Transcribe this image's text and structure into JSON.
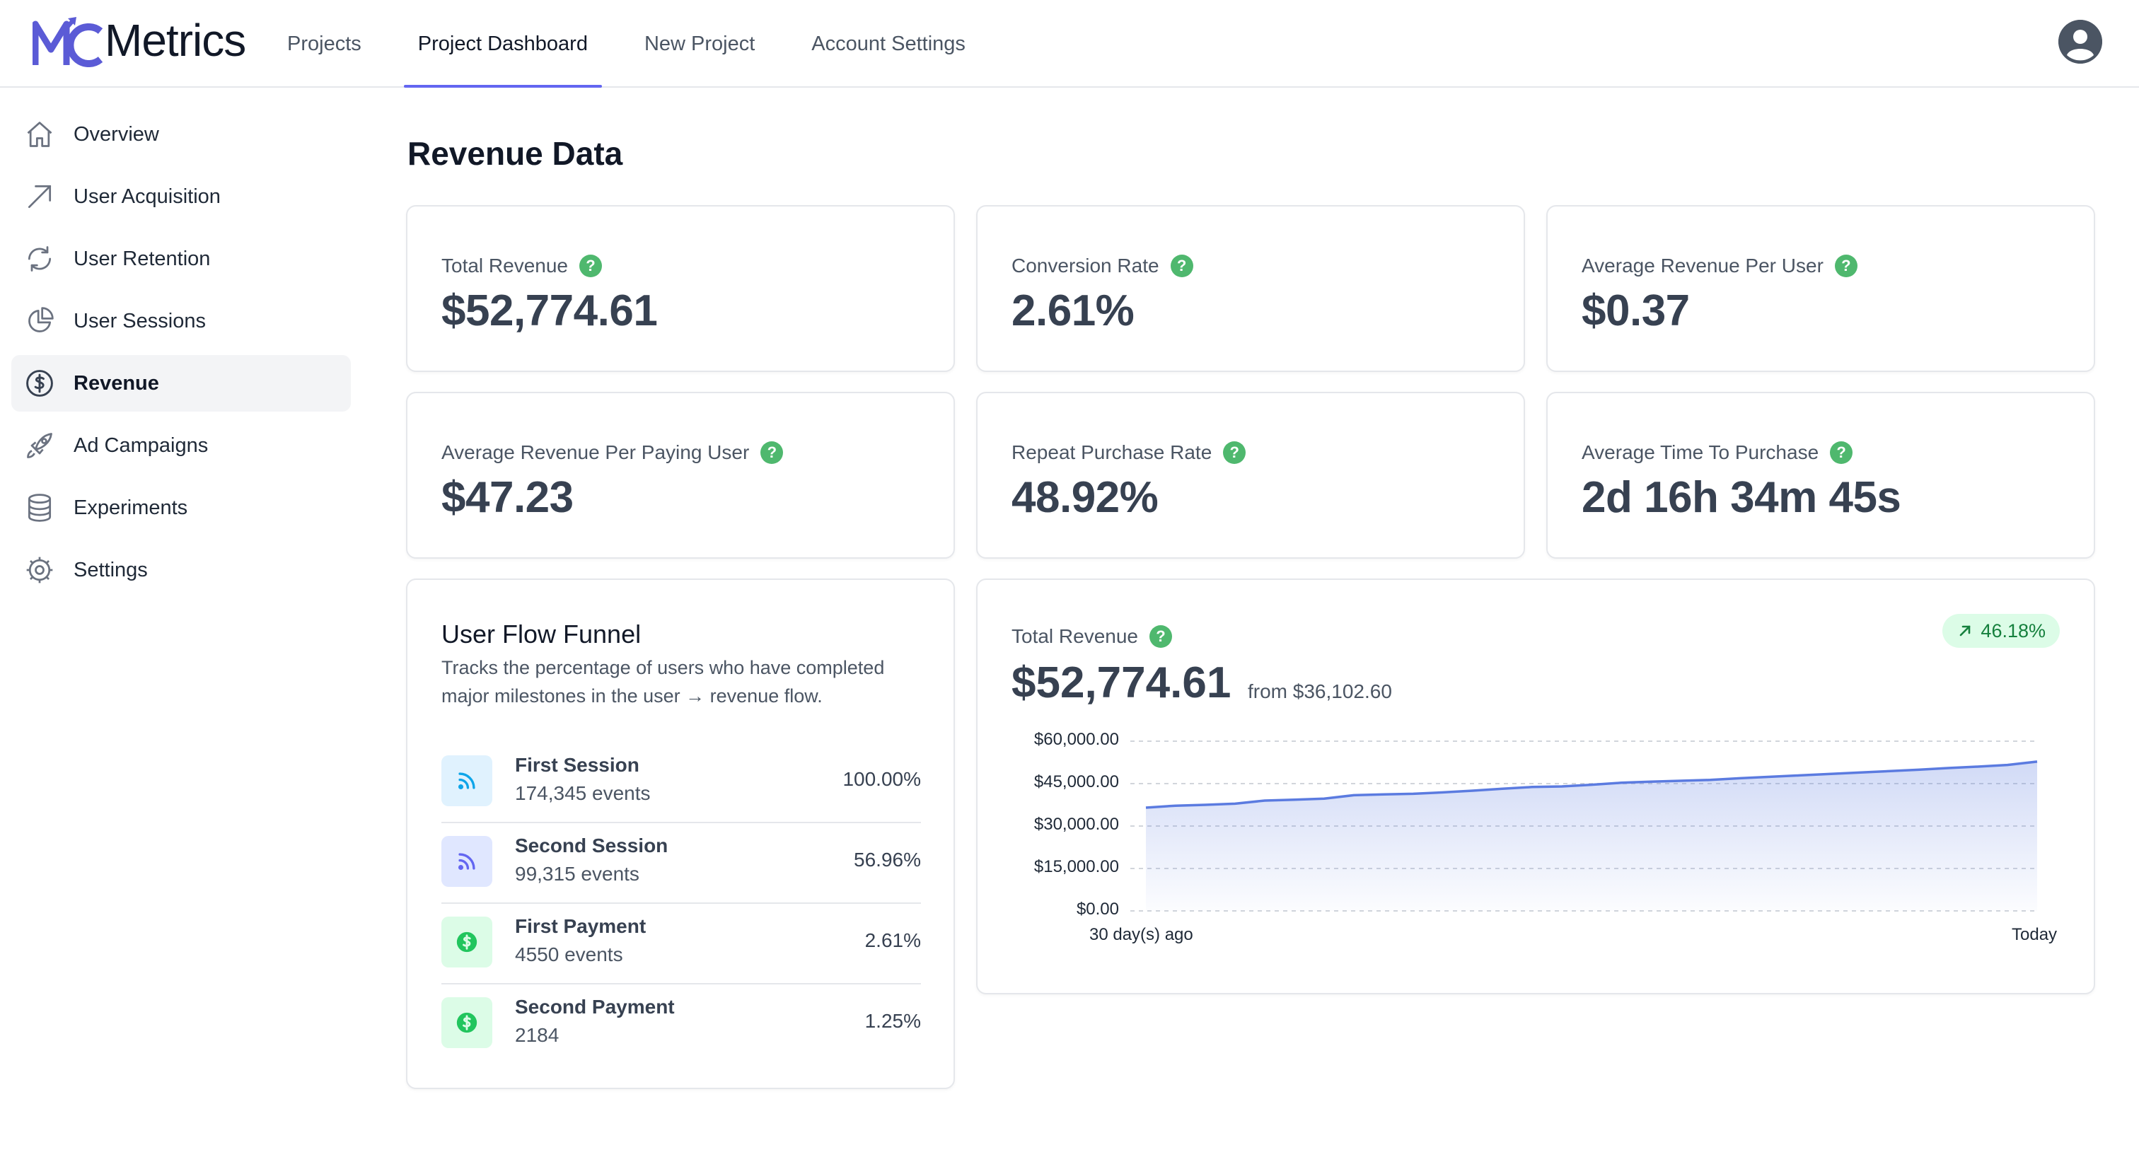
{
  "app": {
    "logo_text": "Metrics",
    "logo_mark": "MC"
  },
  "topnav": {
    "items": [
      {
        "label": "Projects"
      },
      {
        "label": "Project Dashboard",
        "active": true
      },
      {
        "label": "New Project"
      },
      {
        "label": "Account Settings"
      }
    ]
  },
  "sidebar": {
    "items": [
      {
        "label": "Overview",
        "icon": "home-icon"
      },
      {
        "label": "User Acquisition",
        "icon": "arrow-up-right-icon"
      },
      {
        "label": "User Retention",
        "icon": "refresh-icon"
      },
      {
        "label": "User Sessions",
        "icon": "pie-chart-icon"
      },
      {
        "label": "Revenue",
        "icon": "dollar-icon",
        "active": true
      },
      {
        "label": "Ad Campaigns",
        "icon": "rocket-icon"
      },
      {
        "label": "Experiments",
        "icon": "database-icon"
      },
      {
        "label": "Settings",
        "icon": "gear-icon"
      }
    ]
  },
  "main": {
    "title": "Revenue Data",
    "stats": [
      {
        "label": "Total Revenue",
        "value": "$52,774.61"
      },
      {
        "label": "Conversion Rate",
        "value": "2.61%"
      },
      {
        "label": "Average Revenue Per User",
        "value": "$0.37"
      },
      {
        "label": "Average Revenue Per Paying User",
        "value": "$47.23"
      },
      {
        "label": "Repeat Purchase Rate",
        "value": "48.92%"
      },
      {
        "label": "Average Time To Purchase",
        "value": "2d 16h 34m 45s"
      }
    ],
    "help_glyph": "?",
    "funnel": {
      "title": "User Flow Funnel",
      "description": "Tracks the percentage of users who have completed major milestones in the user → revenue flow.",
      "rows": [
        {
          "name": "First Session",
          "events": "174,345 events",
          "pct": "100.00%",
          "icon": "rss-icon",
          "tint": "#e0f2fe",
          "color": "#0ea5e9"
        },
        {
          "name": "Second Session",
          "events": "99,315 events",
          "pct": "56.96%",
          "icon": "rss-icon",
          "tint": "#e0e7ff",
          "color": "#6366f1"
        },
        {
          "name": "First Payment",
          "events": "4550 events",
          "pct": "2.61%",
          "icon": "dollar-icon",
          "tint": "#dcfce7",
          "color": "#22c55e"
        },
        {
          "name": "Second Payment",
          "events": "2184",
          "pct": "1.25%",
          "icon": "dollar-icon",
          "tint": "#dcfce7",
          "color": "#22c55e"
        }
      ]
    },
    "revenue_card": {
      "label": "Total Revenue",
      "value": "$52,774.61",
      "from": "from $36,102.60",
      "change": "46.18%"
    }
  },
  "colors": {
    "accent": "#6366f1",
    "help": "#4fb86e",
    "line": "#5b7be0",
    "badge_bg": "#dcfce7",
    "badge_text": "#15803d"
  },
  "chart_data": {
    "type": "area",
    "x_labels": [
      "30 day(s) ago",
      "Today"
    ],
    "y_ticks": [
      "$0.00",
      "$15,000.00",
      "$30,000.00",
      "$45,000.00",
      "$60,000.00"
    ],
    "y_tick_values": [
      0,
      15000,
      30000,
      45000,
      60000
    ],
    "ylim": [
      0,
      60000
    ],
    "x": [
      0,
      1,
      2,
      3,
      4,
      5,
      6,
      7,
      8,
      9,
      10,
      11,
      12,
      13,
      14,
      15,
      16,
      17,
      18,
      19,
      20,
      21,
      22,
      23,
      24,
      25,
      26,
      27,
      28,
      29,
      30
    ],
    "values": [
      36500,
      37200,
      37500,
      37900,
      39000,
      39300,
      39700,
      40900,
      41200,
      41400,
      41900,
      42500,
      43200,
      43800,
      44000,
      44600,
      45300,
      45700,
      46000,
      46300,
      46900,
      47400,
      47900,
      48400,
      48900,
      49400,
      49900,
      50500,
      51000,
      51600,
      52774.61
    ],
    "grid": "horizontal dashed"
  }
}
